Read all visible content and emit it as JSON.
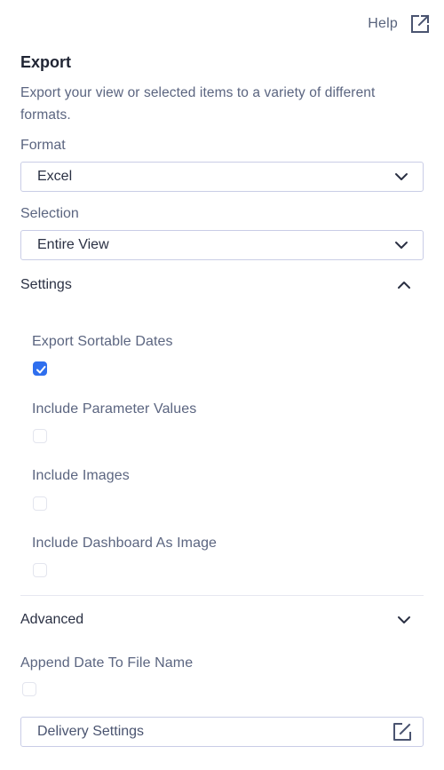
{
  "help": {
    "label": "Help",
    "icon": "external-link-icon"
  },
  "export": {
    "title": "Export",
    "description": "Export your view or selected items to a variety of different formats."
  },
  "format": {
    "label": "Format",
    "value": "Excel"
  },
  "selection": {
    "label": "Selection",
    "value": "Entire View"
  },
  "settings": {
    "title": "Settings",
    "expanded": true,
    "options": [
      {
        "label": "Export Sortable Dates",
        "checked": true
      },
      {
        "label": "Include Parameter Values",
        "checked": false
      },
      {
        "label": "Include Images",
        "checked": false
      },
      {
        "label": "Include Dashboard As Image",
        "checked": false
      }
    ]
  },
  "advanced": {
    "title": "Advanced",
    "expanded": false,
    "append_date": {
      "label": "Append Date To File Name",
      "checked": false
    }
  },
  "delivery": {
    "label": "Delivery Settings",
    "icon": "edit-icon"
  },
  "colors": {
    "accent": "#2f6fee",
    "border": "#c9cde6",
    "text": "#2a3043",
    "muted": "#5b6580"
  }
}
